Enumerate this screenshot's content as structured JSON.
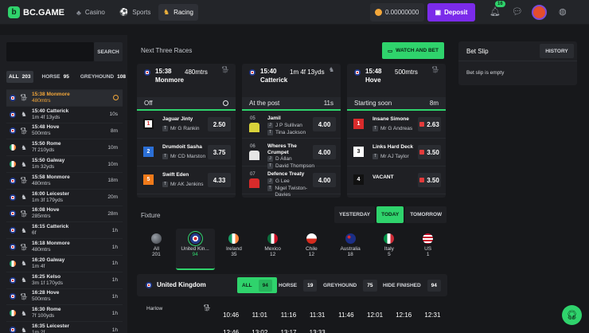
{
  "brand": {
    "name": "BC.GAME"
  },
  "nav": {
    "casino": "Casino",
    "sports": "Sports",
    "racing": "Racing"
  },
  "wallet": {
    "balance": "0.00000000"
  },
  "deposit": {
    "label": "Deposit"
  },
  "notifications": {
    "count": "16"
  },
  "colors": {
    "accent": "#2fd36c",
    "deposit": "#7b2bea",
    "highlight": "#f3a73a"
  },
  "sidebar": {
    "search_label": "SEARCH",
    "filters": [
      {
        "label": "ALL",
        "count": "203"
      },
      {
        "label": "HORSE",
        "count": "95"
      },
      {
        "label": "GREYHOUND",
        "count": "108"
      }
    ],
    "races": [
      {
        "time": "15:38",
        "venue": "Monmore",
        "dist": "480mtrs",
        "right": "",
        "flag": "uk",
        "icon": "dog",
        "hl": true
      },
      {
        "time": "15:40",
        "venue": "Catterick",
        "dist": "1m 4f 13yds",
        "right": "10s",
        "flag": "uk",
        "icon": "horse"
      },
      {
        "time": "15:48",
        "venue": "Hove",
        "dist": "500mtrs",
        "right": "8m",
        "flag": "uk",
        "icon": "dog"
      },
      {
        "time": "15:50",
        "venue": "Rome",
        "dist": "7f 210yds",
        "right": "10m",
        "flag": "ie",
        "icon": "horse"
      },
      {
        "time": "15:50",
        "venue": "Galway",
        "dist": "1m 32yds",
        "right": "10m",
        "flag": "ie",
        "icon": "horse"
      },
      {
        "time": "15:58",
        "venue": "Monmore",
        "dist": "480mtrs",
        "right": "18m",
        "flag": "uk",
        "icon": "dog"
      },
      {
        "time": "16:00",
        "venue": "Leicester",
        "dist": "1m 3f 179yds",
        "right": "20m",
        "flag": "uk",
        "icon": "horse"
      },
      {
        "time": "16:08",
        "venue": "Hove",
        "dist": "285mtrs",
        "right": "28m",
        "flag": "uk",
        "icon": "dog"
      },
      {
        "time": "16:15",
        "venue": "Catterick",
        "dist": "6f",
        "right": "1h",
        "flag": "uk",
        "icon": "horse"
      },
      {
        "time": "16:18",
        "venue": "Monmore",
        "dist": "480mtrs",
        "right": "1h",
        "flag": "uk",
        "icon": "dog"
      },
      {
        "time": "16:20",
        "venue": "Galway",
        "dist": "1m 4f",
        "right": "1h",
        "flag": "ie",
        "icon": "horse"
      },
      {
        "time": "16:25",
        "venue": "Kelso",
        "dist": "3m 1f 170yds",
        "right": "1h",
        "flag": "uk",
        "icon": "horse"
      },
      {
        "time": "16:28",
        "venue": "Hove",
        "dist": "500mtrs",
        "right": "1h",
        "flag": "uk",
        "icon": "dog"
      },
      {
        "time": "16:30",
        "venue": "Rome",
        "dist": "7f 100yds",
        "right": "1h",
        "flag": "ie",
        "icon": "horse"
      },
      {
        "time": "16:35",
        "venue": "Leicester",
        "dist": "1m 2f",
        "right": "1h",
        "flag": "uk",
        "icon": "horse"
      }
    ]
  },
  "next_races": {
    "title": "Next Three Races",
    "watch_label": "WATCH AND BET",
    "cards": [
      {
        "time": "15:38",
        "dist": "480mtrs",
        "venue": "Monmore",
        "status": "Off",
        "status_right": "",
        "runners": [
          {
            "num": "1",
            "num_bg": "#ffffff",
            "num_fg": "#d92b2b",
            "name": "Jaguar Jinty",
            "tag": "T",
            "person": "Mr G Rankin",
            "odds": "2.50"
          },
          {
            "num": "2",
            "num_bg": "#2b6fd6",
            "num_fg": "#ffffff",
            "name": "Drumdoit Sasha",
            "tag": "T",
            "person": "Mr CD Marston",
            "odds": "3.75"
          },
          {
            "num": "5",
            "num_bg": "#f07a1a",
            "num_fg": "#ffffff",
            "name": "Swift Eden",
            "tag": "T",
            "person": "Mr AK Jenkins",
            "odds": "4.33"
          }
        ]
      },
      {
        "time": "15:40",
        "dist": "1m 4f 13yds",
        "venue": "Catterick",
        "status": "At the post",
        "status_right": "11s",
        "runners": [
          {
            "no": "05",
            "silk": "#d8d23a",
            "name": "Jamil",
            "j": "J P Sullivan",
            "t": "Tina Jackson",
            "odds": "4.00"
          },
          {
            "no": "06",
            "silk": "#e6e6e6",
            "name": "Wheres The Crumpet",
            "j": "D Allan",
            "t": "David Thompson",
            "odds": "4.00"
          },
          {
            "no": "07",
            "silk": "#d92b2b",
            "name": "Defence Treaty",
            "j": "G Lee",
            "t": "Nigel Twiston-Davies",
            "odds": "4.00"
          }
        ]
      },
      {
        "time": "15:48",
        "dist": "500mtrs",
        "venue": "Hove",
        "status": "Starting soon",
        "status_right": "8m",
        "runners": [
          {
            "num": "1",
            "num_bg": "#d92b2b",
            "num_fg": "#ffffff",
            "name": "Insane Simone",
            "tag": "T",
            "person": "Mr G Andreas",
            "odds": "2.63"
          },
          {
            "num": "3",
            "num_bg": "#ffffff",
            "num_fg": "#111111",
            "name": "Links Hard Deck",
            "tag": "T",
            "person": "Mr AJ Taylor",
            "odds": "3.50"
          },
          {
            "num": "4",
            "num_bg": "#111111",
            "num_fg": "#ffffff",
            "name": "VACANT",
            "tag": "",
            "person": "",
            "odds": "3.50"
          }
        ]
      }
    ]
  },
  "fixture": {
    "title": "Fixture",
    "tabs": [
      "YESTERDAY",
      "TODAY",
      "TOMORROW"
    ],
    "countries": [
      {
        "name": "All",
        "count": "201",
        "flag": "globe"
      },
      {
        "name": "United Kin...",
        "count": "94",
        "flag": "uk",
        "active": true
      },
      {
        "name": "Ireland",
        "count": "35",
        "flag": "ie"
      },
      {
        "name": "Mexico",
        "count": "12",
        "flag": "mx"
      },
      {
        "name": "Chile",
        "count": "12",
        "flag": "cl"
      },
      {
        "name": "Australia",
        "count": "18",
        "flag": "au"
      },
      {
        "name": "Italy",
        "count": "5",
        "flag": "it"
      },
      {
        "name": "US",
        "count": "1",
        "flag": "us"
      }
    ]
  },
  "uk_section": {
    "title": "United Kingdom",
    "filters": [
      {
        "label": "ALL",
        "count": "94"
      },
      {
        "label": "HORSE",
        "count": "19"
      },
      {
        "label": "GREYHOUND",
        "count": "75"
      },
      {
        "label": "HIDE FINISHED",
        "count": "94"
      }
    ],
    "venue": "Harlow",
    "times": [
      "10:46",
      "11:01",
      "11:16",
      "11:31",
      "11:46",
      "12:01",
      "12:16",
      "12:31",
      "12:46",
      "13:02",
      "13:17",
      "13:33"
    ]
  },
  "betslip": {
    "title": "Bet Slip",
    "history": "HISTORY",
    "empty": "Bet slip is empty"
  }
}
